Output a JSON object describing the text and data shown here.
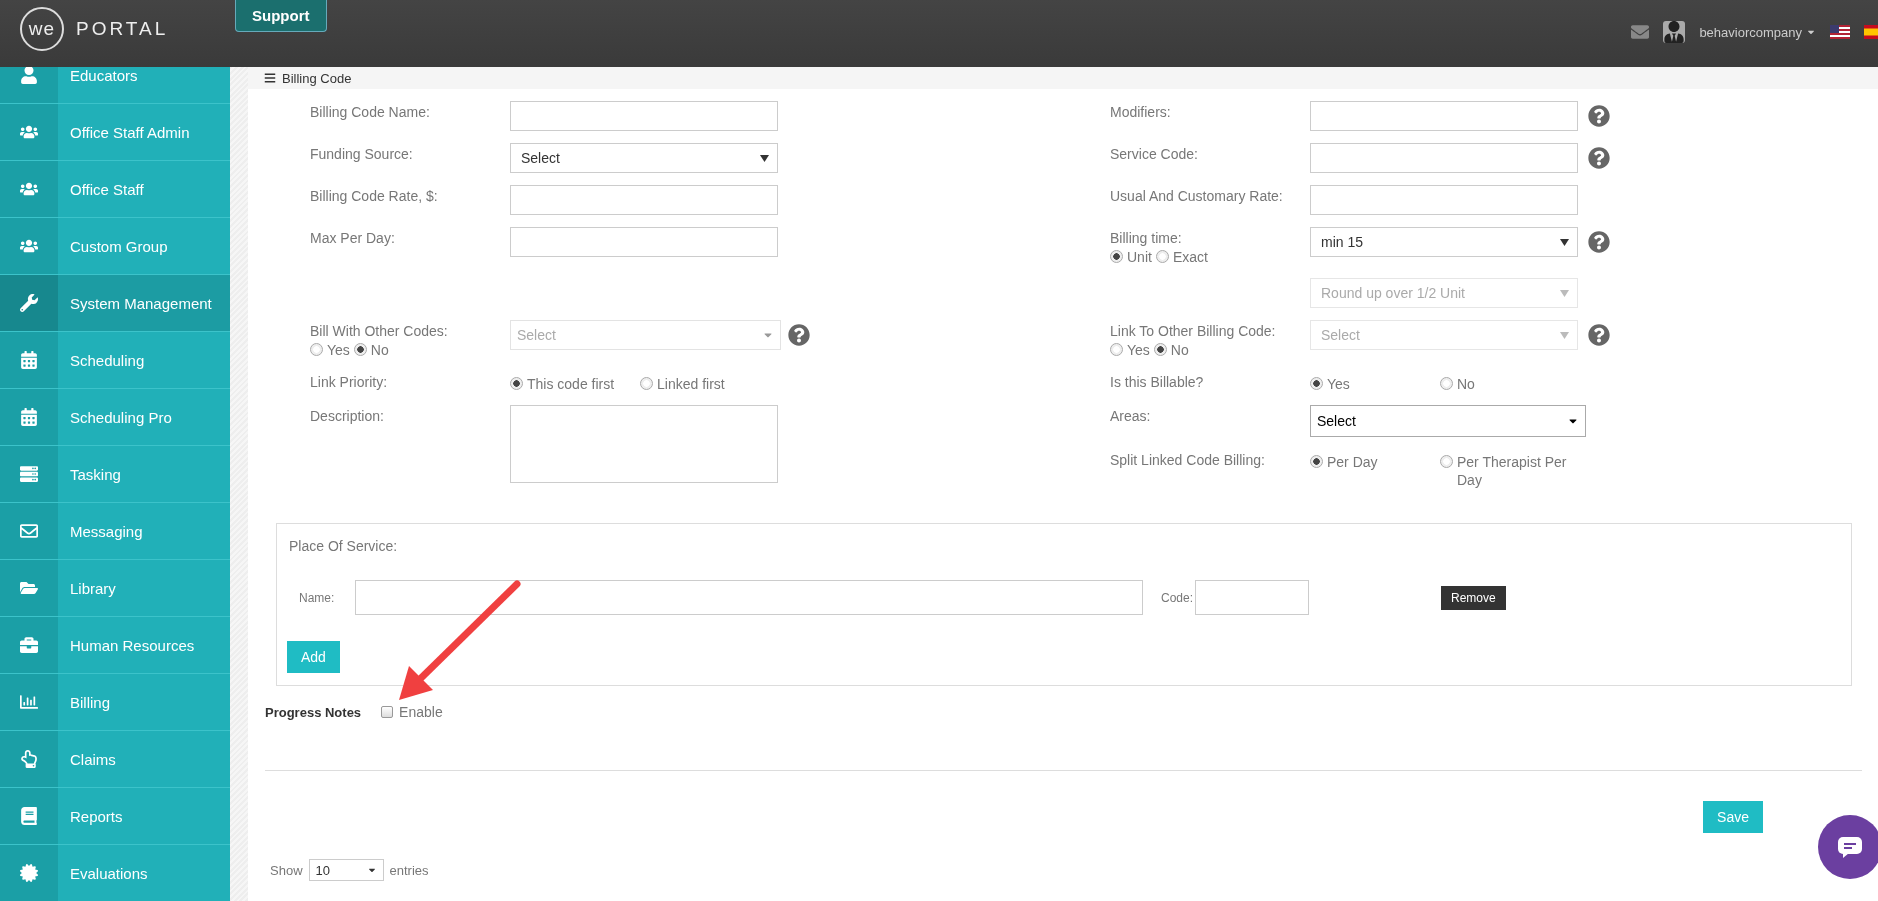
{
  "header": {
    "logo_we": "we",
    "logo_portal": "PORTAL",
    "support_tab": "Support",
    "user": "behaviorcompany"
  },
  "sidebar": {
    "items": [
      {
        "label": "Educators",
        "selected": false
      },
      {
        "label": "Office Staff Admin",
        "selected": false
      },
      {
        "label": "Office Staff",
        "selected": false
      },
      {
        "label": "Custom Group",
        "selected": false
      },
      {
        "label": "System Management",
        "selected": true
      },
      {
        "label": "Scheduling",
        "selected": false
      },
      {
        "label": "Scheduling Pro",
        "selected": false
      },
      {
        "label": "Tasking",
        "selected": false
      },
      {
        "label": "Messaging",
        "selected": false
      },
      {
        "label": "Library",
        "selected": false
      },
      {
        "label": "Human Resources",
        "selected": false
      },
      {
        "label": "Billing",
        "selected": false
      },
      {
        "label": "Claims",
        "selected": false
      },
      {
        "label": "Reports",
        "selected": false
      },
      {
        "label": "Evaluations",
        "selected": false
      }
    ]
  },
  "form": {
    "title": "Billing Code",
    "rows": [
      {
        "left": {
          "label": "Billing Code Name:",
          "control": {
            "kind": "input"
          },
          "help": false
        },
        "right": {
          "label": "Modifiers:",
          "control": {
            "kind": "input"
          },
          "help": true
        }
      },
      {
        "left": {
          "label": "Funding Source:",
          "control": {
            "kind": "select",
            "value": "Select",
            "disabled": false
          },
          "help": false
        },
        "right": {
          "label": "Service Code:",
          "control": {
            "kind": "input"
          },
          "help": true
        }
      },
      {
        "left": {
          "label": "Billing Code Rate, $:",
          "control": {
            "kind": "input"
          },
          "help": false
        },
        "right": {
          "label": "Usual And Customary Rate:",
          "control": {
            "kind": "input"
          },
          "help": false
        }
      },
      {
        "left": {
          "label": "Max Per Day:",
          "control": {
            "kind": "input"
          },
          "help": false
        },
        "right": {
          "label": "Billing time:",
          "label_options": [
            {
              "label": "Unit",
              "selected": true
            },
            {
              "label": "Exact",
              "selected": false
            }
          ],
          "control": {
            "kind": "select",
            "value": "min 15",
            "disabled": false
          },
          "help": true
        }
      },
      {
        "left": null,
        "right": {
          "control": {
            "kind": "select",
            "value": "Round up over 1/2 Unit",
            "disabled": true
          },
          "help": false
        }
      },
      {
        "left": {
          "label": "Bill With Other Codes:",
          "label_options": [
            {
              "label": "Yes",
              "selected": false
            },
            {
              "label": "No",
              "selected": true
            }
          ],
          "control": {
            "kind": "combo",
            "value": "Select",
            "disabled": true
          },
          "help": true
        },
        "right": {
          "label": "Link To Other Billing Code:",
          "label_options": [
            {
              "label": "Yes",
              "selected": false
            },
            {
              "label": "No",
              "selected": true
            }
          ],
          "control": {
            "kind": "select",
            "value": "Select",
            "disabled": true
          },
          "help": true
        }
      },
      {
        "left": {
          "label": "Link Priority:",
          "control": {
            "kind": "radios",
            "options": [
              {
                "label": "This code first",
                "selected": true
              },
              {
                "label": "Linked first",
                "selected": false
              }
            ]
          },
          "help": false
        },
        "right": {
          "label": "Is this Billable?",
          "control": {
            "kind": "radios",
            "options": [
              {
                "label": "Yes",
                "selected": true
              },
              {
                "label": "No",
                "selected": false
              }
            ]
          },
          "help": false
        }
      },
      {
        "left": {
          "label": "Description:",
          "control": {
            "kind": "textarea"
          },
          "help": false
        },
        "right": {
          "label": "Areas:",
          "control": {
            "kind": "combo",
            "value": "Select",
            "disabled": false
          },
          "help": false
        }
      },
      {
        "left": null,
        "right": {
          "label": "Split Linked Code Billing:",
          "control": {
            "kind": "radios",
            "options": [
              {
                "label": "Per Day",
                "selected": true
              },
              {
                "label": "Per Therapist Per Day",
                "selected": false
              }
            ]
          },
          "help": false
        }
      }
    ]
  },
  "place_of_service": {
    "title": "Place Of Service:",
    "rows": [
      {
        "name_label": "Name:",
        "code_label": "Code:",
        "remove": "Remove"
      }
    ],
    "add": "Add"
  },
  "progress_notes": {
    "label": "Progress Notes",
    "option": {
      "label": "Enable",
      "checked": false
    }
  },
  "save": "Save",
  "entries": {
    "show": "Show",
    "value": "10",
    "suffix": "entries"
  }
}
